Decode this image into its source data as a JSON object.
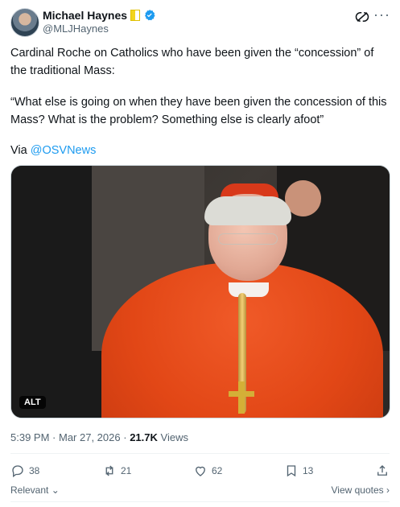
{
  "author": {
    "name": "Michael Haynes",
    "handle": "@MLJHaynes"
  },
  "post": {
    "line1": "Cardinal Roche on Catholics who have been given the “concession” of the traditional Mass:",
    "quote": "“What else is going on when they have been given the concession of this Mass? What is the problem? Something else is clearly afoot”",
    "via_prefix": "Via ",
    "via_link": "@OSVNews",
    "media_alt_badge": "ALT",
    "time": "5:39 PM",
    "date": "Mar 27, 2026",
    "views_count": "21.7K",
    "views_label": "Views"
  },
  "actions": {
    "replies": "38",
    "retweets": "21",
    "likes": "62",
    "bookmarks": "13"
  },
  "footer": {
    "relevant_label": "Relevant",
    "view_quotes_label": "View quotes"
  },
  "colors": {
    "link": "#1d9bf0",
    "muted": "#536471",
    "text": "#0f1419"
  },
  "icons": [
    "verified-badge-icon",
    "grok-icon",
    "more-icon",
    "reply-icon",
    "retweet-icon",
    "like-icon",
    "bookmark-icon",
    "share-icon",
    "chevron-down-icon",
    "chevron-right-icon",
    "flag-icon"
  ]
}
